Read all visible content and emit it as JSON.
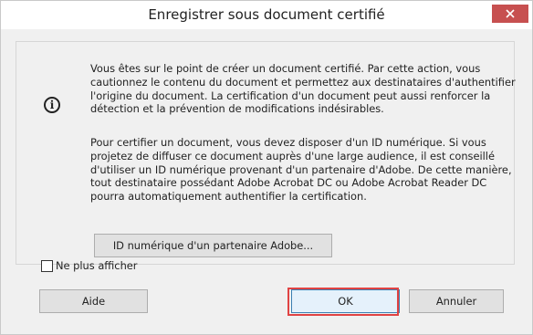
{
  "dialog": {
    "title": "Enregistrer sous document certifié",
    "close_icon": "close-icon",
    "info_icon": "info-icon",
    "info_glyph": "i",
    "paragraph1": "Vous êtes sur le point de créer un document certifié. Par cette action, vous cautionnez le contenu du document et permettez aux destinataires d'authentifier l'origine du document. La certification d'un document peut aussi renforcer la détection et la prévention de modifications indésirables.",
    "paragraph2": "Pour certifier un document, vous devez disposer d'un ID numérique. Si vous projetez de diffuser ce document auprès d'une large audience, il est conseillé d'utiliser un ID numérique provenant d'un partenaire d'Adobe. De cette manière, tout destinataire possédant Adobe Acrobat DC ou Adobe Acrobat Reader DC pourra automatiquement authentifier la certification.",
    "partner_button_label": "ID numérique d'un partenaire Adobe...",
    "checkbox_label": "Ne plus afficher",
    "checkbox_checked": false,
    "help_button_label": "Aide",
    "ok_button_label": "OK",
    "cancel_button_label": "Annuler",
    "highlight_color": "#e04343",
    "close_button_color": "#c75050"
  }
}
